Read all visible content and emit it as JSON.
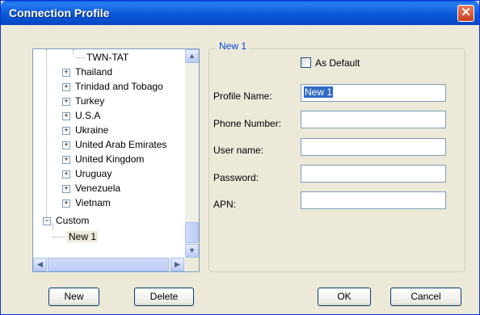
{
  "window": {
    "title": "Connection Profile",
    "close_glyph": "✕"
  },
  "tree": {
    "items": [
      {
        "label": "TWN-TAT",
        "kind": "leaf"
      },
      {
        "label": "Thailand",
        "kind": "collapsed"
      },
      {
        "label": "Trinidad and Tobago",
        "kind": "collapsed"
      },
      {
        "label": "Turkey",
        "kind": "collapsed"
      },
      {
        "label": "U.S.A",
        "kind": "collapsed"
      },
      {
        "label": "Ukraine",
        "kind": "collapsed"
      },
      {
        "label": "United Arab Emirates",
        "kind": "collapsed"
      },
      {
        "label": "United Kingdom",
        "kind": "collapsed"
      },
      {
        "label": "Uruguay",
        "kind": "collapsed"
      },
      {
        "label": "Venezuela",
        "kind": "collapsed"
      },
      {
        "label": "Vietnam",
        "kind": "collapsed"
      },
      {
        "label": "Custom",
        "kind": "expanded"
      },
      {
        "label": "New 1",
        "kind": "selected-leaf"
      }
    ],
    "expand_glyph": "+",
    "collapse_glyph": "−",
    "scroll_up_glyph": "▲",
    "scroll_down_glyph": "▼",
    "scroll_left_glyph": "◀",
    "scroll_right_glyph": "▶"
  },
  "profile": {
    "group_title": "New 1",
    "as_default_label": "As Default",
    "as_default_checked": false,
    "fields": [
      {
        "label": "Profile Name:",
        "value": "New 1"
      },
      {
        "label": "Phone Number:",
        "value": ""
      },
      {
        "label": "User name:",
        "value": ""
      },
      {
        "label": "Password:",
        "value": ""
      },
      {
        "label": "APN:",
        "value": ""
      }
    ]
  },
  "buttons": {
    "new": "New",
    "delete": "Delete",
    "ok": "OK",
    "cancel": "Cancel"
  },
  "colors": {
    "title_bar": "#0a5ed8",
    "close": "#c6411f",
    "selection": "#316ac5",
    "dialog_bg": "#ece9d8"
  }
}
